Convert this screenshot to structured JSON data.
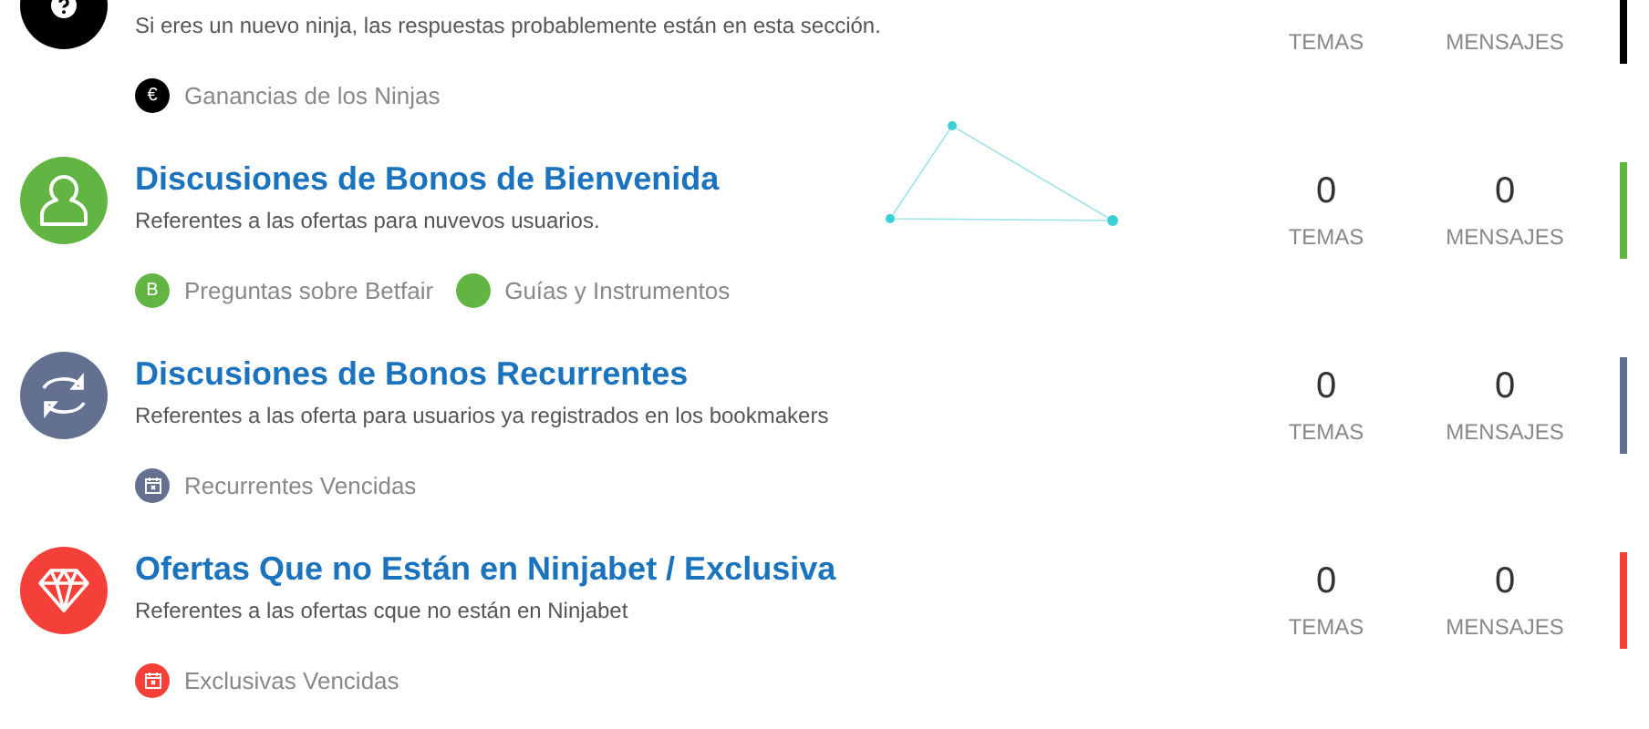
{
  "forums": [
    {
      "kind": "question",
      "color": "#000000",
      "description": "Si eres un nuevo ninja, las respuestas probablemente están en esta sección.",
      "subforums": [
        {
          "label": "Ganancias de los Ninjas",
          "badge": "€",
          "kind": "badge",
          "color": "#000000"
        }
      ],
      "stats": [
        {
          "label": "TEMAS"
        },
        {
          "label": "MENSAJES"
        }
      ]
    },
    {
      "kind": "person",
      "color": "#62b543",
      "title": "Discusiones de Bonos de Bienvenida",
      "description": "Referentes a las ofertas para nuvevos usuarios.",
      "subforums": [
        {
          "label": "Preguntas sobre Betfair",
          "badge": "B",
          "kind": "badge",
          "color": "#62b543"
        },
        {
          "label": "Guías y Instrumentos",
          "kind": "blank",
          "color": "#62b543"
        }
      ],
      "stats": [
        {
          "value": "0",
          "label": "TEMAS"
        },
        {
          "value": "0",
          "label": "MENSAJES"
        }
      ]
    },
    {
      "kind": "refresh",
      "color": "#63708f",
      "title": "Discusiones de Bonos Recurrentes",
      "description": "Referentes a las oferta para usuarios ya registrados en los bookmakers",
      "subforums": [
        {
          "label": "Recurrentes Vencidas",
          "kind": "calendar",
          "color": "#63708f"
        }
      ],
      "stats": [
        {
          "value": "0",
          "label": "TEMAS"
        },
        {
          "value": "0",
          "label": "MENSAJES"
        }
      ]
    },
    {
      "kind": "diamond",
      "color": "#f5403a",
      "title": "Ofertas Que no Están en Ninjabet / Exclusiva",
      "description": "Referentes a las ofertas cque no están en Ninjabet",
      "subforums": [
        {
          "label": "Exclusivas Vencidas",
          "kind": "calendar",
          "color": "#f5403a"
        }
      ],
      "stats": [
        {
          "value": "0",
          "label": "TEMAS"
        },
        {
          "value": "0",
          "label": "MENSAJES"
        }
      ]
    }
  ]
}
